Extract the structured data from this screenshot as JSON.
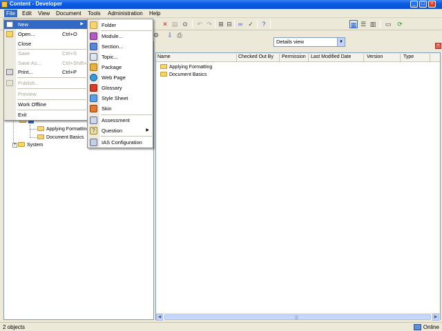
{
  "window": {
    "title": "Content - Developer"
  },
  "menubar": {
    "items": [
      {
        "label": "File"
      },
      {
        "label": "Edit"
      },
      {
        "label": "View"
      },
      {
        "label": "Document"
      },
      {
        "label": "Tools"
      },
      {
        "label": "Administration"
      },
      {
        "label": "Help"
      }
    ]
  },
  "toolbar": {
    "view_select": "Details view"
  },
  "file_menu": {
    "items": [
      {
        "label": "New",
        "shortcut": ""
      },
      {
        "label": "Open...",
        "shortcut": "Ctrl+O"
      },
      {
        "label": "Close",
        "shortcut": ""
      },
      {
        "label": "Save",
        "shortcut": "Ctrl+S"
      },
      {
        "label": "Save As...",
        "shortcut": "Ctrl+Shift+A"
      },
      {
        "label": "Print...",
        "shortcut": "Ctrl+P"
      },
      {
        "label": "Publish...",
        "shortcut": ""
      },
      {
        "label": "Preview",
        "shortcut": ""
      },
      {
        "label": "Work Offline",
        "shortcut": ""
      },
      {
        "label": "Exit",
        "shortcut": ""
      }
    ]
  },
  "new_menu": {
    "items": [
      {
        "label": "Folder"
      },
      {
        "label": "Module..."
      },
      {
        "label": "Section..."
      },
      {
        "label": "Topic..."
      },
      {
        "label": "Package"
      },
      {
        "label": "Web Page"
      },
      {
        "label": "Glossary"
      },
      {
        "label": "Style Sheet"
      },
      {
        "label": "Skin"
      },
      {
        "label": "Assessment"
      },
      {
        "label": "Question"
      },
      {
        "label": "IAS Configuration"
      }
    ]
  },
  "tree": {
    "items": [
      {
        "label": "Applying Formatting"
      },
      {
        "label": "Document Basics"
      },
      {
        "label": "System"
      }
    ]
  },
  "list": {
    "columns": [
      "Name",
      "Checked Out By",
      "Permission",
      "Last Modified Date",
      "Version",
      "Type"
    ],
    "rows": [
      {
        "name": "Applying Formatting"
      },
      {
        "name": "Document Basics"
      }
    ]
  },
  "status": {
    "left": "2 objects",
    "right": "Online"
  }
}
